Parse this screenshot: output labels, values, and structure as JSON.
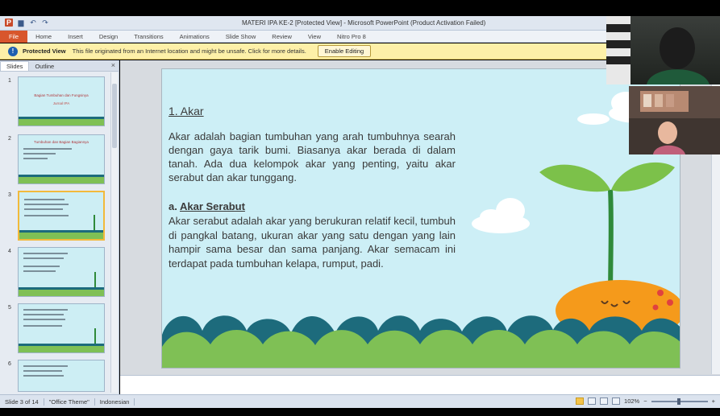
{
  "window": {
    "title": "MATERI IPA KE-2 [Protected View] - Microsoft PowerPoint (Product Activation Failed)"
  },
  "quick_access": {
    "icons": [
      "powerpoint-logo-icon",
      "save-icon",
      "undo-icon",
      "redo-icon"
    ],
    "logo_letter": "P",
    "save_glyph": "▆",
    "undo_glyph": "↶",
    "redo_glyph": "↷"
  },
  "ribbon": {
    "tabs": [
      "File",
      "Home",
      "Insert",
      "Design",
      "Transitions",
      "Animations",
      "Slide Show",
      "Review",
      "View",
      "Nitro Pro 8"
    ]
  },
  "protected_view": {
    "title": "Protected View",
    "message": "This file originated from an Internet location and might be unsafe. Click for more details.",
    "button": "Enable Editing",
    "icon_glyph": "!"
  },
  "slides_pane": {
    "tabs": [
      "Slides",
      "Outline"
    ],
    "close_glyph": "×",
    "thumbnails": [
      {
        "number": "1",
        "caption": "Bagian Tumbuhan dan Fungsinya",
        "sub": "Jurnal IPA",
        "active": false
      },
      {
        "number": "2",
        "caption": "Tumbuhan dan Bagian Bagiannya",
        "sub": "",
        "active": false
      },
      {
        "number": "3",
        "caption": "",
        "sub": "",
        "active": true
      },
      {
        "number": "4",
        "caption": "",
        "sub": "",
        "active": false
      },
      {
        "number": "5",
        "caption": "",
        "sub": "",
        "active": false
      },
      {
        "number": "6",
        "caption": "",
        "sub": "",
        "active": false
      }
    ]
  },
  "slide": {
    "heading": "1. Akar",
    "para1": "Akar adalah bagian tumbuhan yang arah tumbuhnya searah dengan gaya tarik bumi. Biasanya akar berada di dalam tanah. Ada dua kelompok akar yang penting, yaitu akar serabut dan akar tunggang.",
    "subhead_prefix": "a. ",
    "subhead": "Akar Serabut",
    "para2": "Akar serabut adalah akar yang berukuran relatif kecil, tumbuh di pangkal batang, ukuran akar yang satu dengan yang lain hampir sama besar dan sama panjang. Akar semacam ini terdapat pada tumbuhan kelapa, rumput, padi.",
    "colors": {
      "sky": "#cdeff6",
      "text": "#3a3a3a",
      "wave_dark": "#1d6b7c",
      "wave_light": "#7fc055",
      "sun_orange": "#f59a1b"
    }
  },
  "statusbar": {
    "slide_info": "Slide 3 of 14",
    "theme": "\"Office Theme\"",
    "language": "Indonesian",
    "zoom": "102%",
    "zoom_minus": "−",
    "zoom_plus": "+"
  }
}
